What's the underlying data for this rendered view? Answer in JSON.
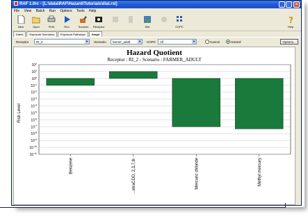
{
  "window": {
    "title": "RAF 1.0rc - [L:\\data\\RAF\\Hazard\\Tutorials\\d\\at.rsl]"
  },
  "menu": [
    "File",
    "View",
    "Batch",
    "Run",
    "Options",
    "Tools",
    "Help"
  ],
  "toolbar": {
    "buttons": [
      {
        "label": "New",
        "icon": "new-icon"
      },
      {
        "label": "Open",
        "icon": "open-icon"
      },
      {
        "label": "Print",
        "icon": "print-icon"
      },
      {
        "label": "Run",
        "icon": "run-icon"
      },
      {
        "label": "Sources",
        "icon": "sources-icon"
      },
      {
        "label": "Receptor",
        "icon": "receptor-icon"
      },
      {
        "label": "",
        "icon": "disabled-icon"
      },
      {
        "label": "",
        "icon": "disabled-icon"
      },
      {
        "label": "Site",
        "icon": "site-icon"
      },
      {
        "label": "",
        "icon": "disabled-icon"
      },
      {
        "label": "COPC",
        "icon": "copc-icon"
      },
      {
        "label": "Help",
        "icon": "help-icon"
      }
    ]
  },
  "tabs": [
    "Dates",
    "Exposure Scenarios",
    "Exposure Pathways",
    "Graph"
  ],
  "active_tab": "Graph",
  "filters": {
    "receptor_label": "Receptor",
    "receptor_value": "RI_2",
    "scenario_label": "Scenario",
    "scenario_value": "farmer_adult",
    "copc_label": "COPC",
    "copc_value": "All",
    "radio_cancer": "Cancer",
    "radio_hazard": "Hazard",
    "options_button": "Options..."
  },
  "chart_data": {
    "type": "bar",
    "title": "Hazard Quotient",
    "subtitle": "Receptor : RI_2 -  Scenario : FARMER_ADULT",
    "ylabel": "Risk Level",
    "yscale": "log",
    "ylim_exp": [
      -11,
      2
    ],
    "categories": [
      "Benzene",
      "...etraCDD, 2,3,7,8-",
      "Mercuric chloride",
      "Methyl mercury"
    ],
    "values": [
      0.1,
      10,
      1e-07,
      5e-08
    ],
    "bar_color": "#1a7a3c",
    "grid": true
  }
}
